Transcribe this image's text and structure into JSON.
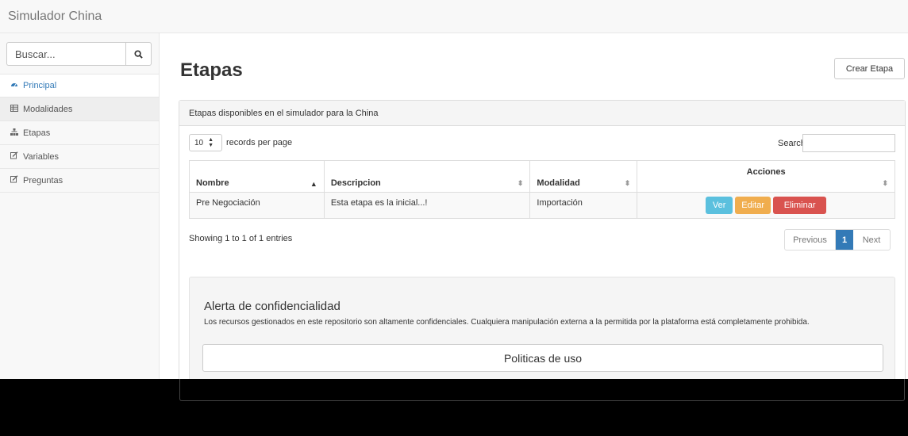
{
  "navbar": {
    "brand": "Simulador China"
  },
  "sidebar": {
    "search_placeholder": "Buscar...",
    "items": [
      {
        "label": "Principal",
        "icon": "dashboard-icon"
      },
      {
        "label": "Modalidades",
        "icon": "table-icon"
      },
      {
        "label": "Etapas",
        "icon": "sitemap-icon"
      },
      {
        "label": "Variables",
        "icon": "edit-icon"
      },
      {
        "label": "Preguntas",
        "icon": "edit-icon"
      }
    ]
  },
  "main": {
    "title": "Etapas",
    "create_button": "Crear Etapa",
    "panel_heading": "Etapas disponibles en el simulador para la China",
    "records_value": "10",
    "records_label": "records per page",
    "search_label": "Search:",
    "table": {
      "headers": [
        "Nombre",
        "Descripcion",
        "Modalidad",
        "Acciones"
      ],
      "rows": [
        {
          "nombre": "Pre Negociación",
          "descripcion": "Esta etapa es la inicial...!",
          "modalidad": "Importación"
        }
      ],
      "actions": {
        "ver": "Ver",
        "editar": "Editar",
        "eliminar": "Eliminar"
      }
    },
    "showing": "Showing 1 to 1 of 1 entries",
    "pagination": {
      "previous": "Previous",
      "current": "1",
      "next": "Next"
    }
  },
  "alert": {
    "title": "Alerta de confidencialidad",
    "text": "Los recursos gestionados en este repositorio son altamente confidenciales. Cualquiera manipulación externa a la permitida por la plataforma está completamente prohibida.",
    "button": "Politicas de uso"
  },
  "colors": {
    "link_blue": "#337ab7",
    "info": "#5bc0de",
    "warning": "#f0ad4e",
    "danger": "#d9534f"
  }
}
